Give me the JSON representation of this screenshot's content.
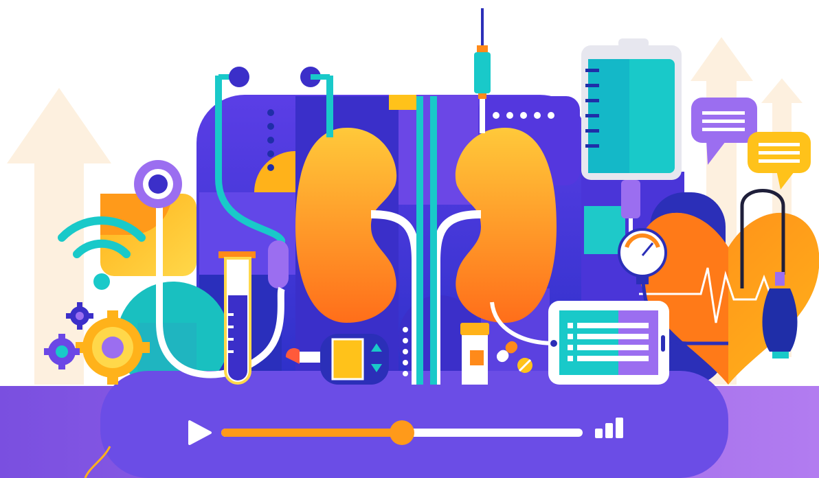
{
  "player": {
    "progress": 0.5,
    "volume_level": 3,
    "play_icon": "play-icon",
    "volume_icon": "volume-bars-icon"
  },
  "colors": {
    "purple_dark": "#3b2fc9",
    "purple": "#6b47e6",
    "purple_light": "#9b74f0",
    "navy": "#1f2ea8",
    "orange": "#ff8a1a",
    "orange_deep": "#ff6a1a",
    "yellow": "#ffc21a",
    "teal": "#19c9c9",
    "cream": "#fdf0df",
    "white": "#ffffff",
    "heart": "#ff7a18"
  },
  "icons": [
    "kidneys-icon",
    "stethoscope-icon",
    "iv-bag-icon",
    "syringe-icon",
    "heart-icon",
    "blood-pressure-gauge-icon",
    "test-tube-icon",
    "tablet-icon",
    "pill-bottle-icon",
    "pills-icon",
    "wifi-icon",
    "gear-icon",
    "chat-bubble-icon",
    "arrow-up-icon",
    "glucose-meter-icon"
  ]
}
